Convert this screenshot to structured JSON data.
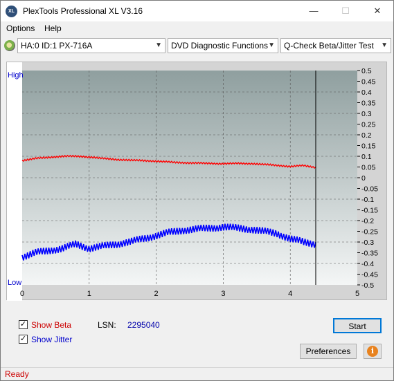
{
  "window": {
    "title": "PlexTools Professional XL V3.16",
    "icon_label": "XL"
  },
  "titlebar_buttons": {
    "minimize": "—",
    "maximize": "☐",
    "close": "✕"
  },
  "menu": {
    "options": "Options",
    "help": "Help"
  },
  "toolbar": {
    "drive": "HA:0 ID:1  PX-716A",
    "function": "DVD Diagnostic Functions",
    "test": "Q-Check Beta/Jitter Test"
  },
  "chart_data": {
    "type": "line",
    "left_axis_labels": {
      "high": "High",
      "low": "Low"
    },
    "x_ticks": [
      "0",
      "1",
      "2",
      "3",
      "4",
      "5"
    ],
    "xlim": [
      0,
      5
    ],
    "y_right_ticks": [
      "0.5",
      "0.45",
      "0.4",
      "0.35",
      "0.3",
      "0.25",
      "0.2",
      "0.15",
      "0.1",
      "0.05",
      "0",
      "-0.05",
      "-0.1",
      "-0.15",
      "-0.2",
      "-0.25",
      "-0.3",
      "-0.35",
      "-0.4",
      "-0.45",
      "-0.5"
    ],
    "ylim": [
      -0.5,
      0.5
    ],
    "grid": true,
    "end_marker_x": 4.38,
    "series": [
      {
        "color": "#ff0000",
        "x": [
          0,
          0.2,
          0.4,
          0.6,
          0.8,
          1.0,
          1.2,
          1.4,
          1.6,
          1.8,
          2.0,
          2.2,
          2.4,
          2.6,
          2.8,
          3.0,
          3.2,
          3.4,
          3.6,
          3.8,
          4.0,
          4.2,
          4.38
        ],
        "values": [
          0.08,
          0.09,
          0.095,
          0.1,
          0.1,
          0.097,
          0.09,
          0.085,
          0.082,
          0.08,
          0.077,
          0.073,
          0.07,
          0.068,
          0.067,
          0.065,
          0.067,
          0.066,
          0.062,
          0.058,
          0.052,
          0.057,
          0.048
        ]
      },
      {
        "color": "#0000ff",
        "x": [
          0,
          0.2,
          0.4,
          0.6,
          0.8,
          1.0,
          1.2,
          1.4,
          1.6,
          1.8,
          2.0,
          2.2,
          2.4,
          2.6,
          2.8,
          3.0,
          3.2,
          3.4,
          3.6,
          3.8,
          4.0,
          4.2,
          4.38
        ],
        "values": [
          -0.37,
          -0.35,
          -0.34,
          -0.33,
          -0.31,
          -0.33,
          -0.32,
          -0.31,
          -0.3,
          -0.285,
          -0.27,
          -0.255,
          -0.245,
          -0.24,
          -0.235,
          -0.23,
          -0.235,
          -0.24,
          -0.25,
          -0.26,
          -0.285,
          -0.3,
          -0.31
        ]
      }
    ]
  },
  "checks": {
    "show_beta": {
      "label": "Show Beta",
      "checked": true,
      "color": "#cc0000"
    },
    "show_jitter": {
      "label": "Show Jitter",
      "checked": true,
      "color": "#0000cc"
    }
  },
  "lsn": {
    "label": "LSN:",
    "value": "2295040"
  },
  "buttons": {
    "start": "Start",
    "preferences": "Preferences",
    "info": "i"
  },
  "status": {
    "text": "Ready",
    "color": "#cc0000"
  }
}
